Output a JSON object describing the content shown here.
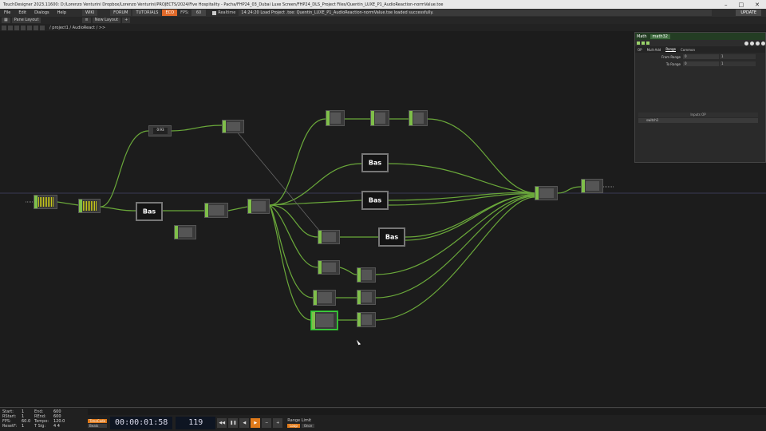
{
  "title_bar": {
    "title": "TouchDesigner 2023.11600: D:/Lorenzo Venturini Dropbox/Lorenzo Venturini/PROJECTS/2024/Five Hospitality - Pacha/FHP24_03_Dubai Luxe Screen/FHP24_DLS_Project Files/Quentin_LUXE_P1_AudioReaction-normValue.toe"
  },
  "menu": {
    "items": [
      "File",
      "Edit",
      "Dialogs",
      "Help"
    ],
    "wiki": "WIKI",
    "forum": "FORUM",
    "tutorials": "TUTORIALS",
    "eco": "ECO",
    "fps_label": "FPS:",
    "fps_value": "60",
    "realtime": "Realtime",
    "status": "14:24:20 Load Project .toe: Quentin_LUXE_P1_AudioReaction-normValue.toe loaded successfully.",
    "update": "UPDATE"
  },
  "toolbar": {
    "pane_layout": "Pane Layout",
    "new_layout": "New Layout",
    "plus": "+"
  },
  "path": {
    "text": "/ project1 / AudioReact / >>"
  },
  "nodes": {
    "bas": "Bas",
    "txt1": "0:93"
  },
  "panel": {
    "header_label": "Math",
    "header_name": "math32",
    "tabs": [
      "OP",
      "Mult-Add",
      "Range",
      "Common"
    ],
    "active_tab": "Range",
    "params": [
      {
        "label": "From Range",
        "v1": "0",
        "v2": "1"
      },
      {
        "label": "To Range",
        "v1": "0",
        "v2": "1"
      }
    ],
    "inputs_header": "Inputs OP",
    "inputs": [
      "switch1"
    ]
  },
  "stats": {
    "start_label": "Start:",
    "start": "1",
    "end_label": "End:",
    "end": "600",
    "rstart_label": "RStart:",
    "rstart": "1",
    "rend_label": "REnd:",
    "rend": "600",
    "fps_label": "FPS:",
    "fps": "60.0",
    "tempo_label": "Tempo:",
    "tempo": "120.0",
    "resetf_label": "ResetF:",
    "resetf": "1",
    "tsig_label": "T Sig:",
    "tsig": "4   4"
  },
  "transport": {
    "timecode": "00:00:01:58",
    "frame": "119",
    "timecode_mode": "TimeCode",
    "beats": "Beats",
    "range_limit": "Range Limit",
    "loop": "Loop",
    "once": "Once"
  }
}
